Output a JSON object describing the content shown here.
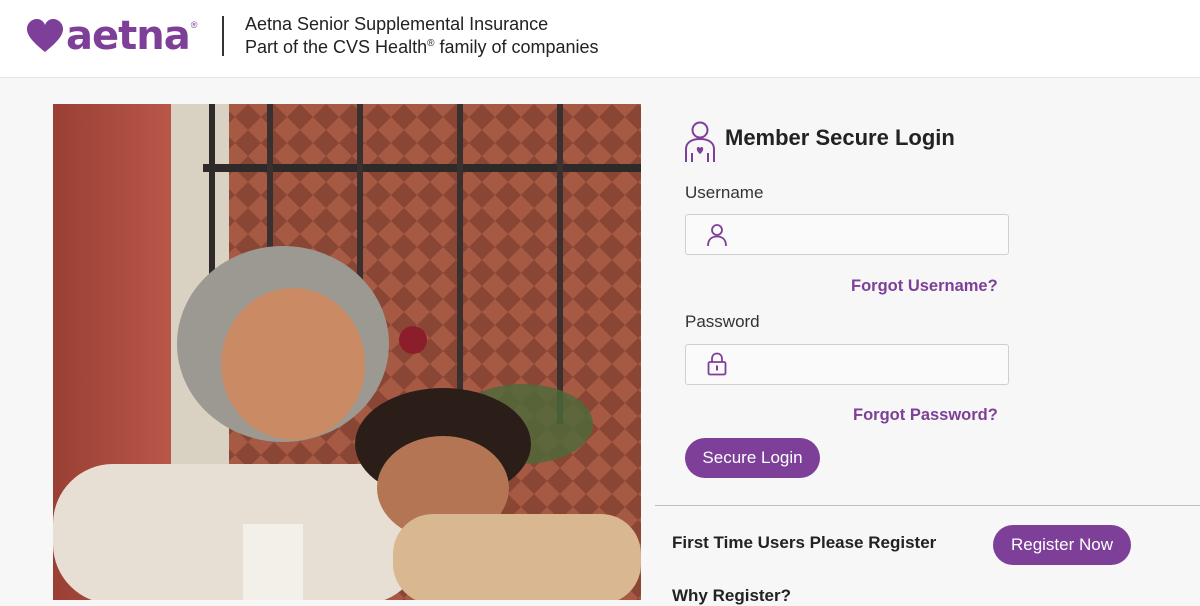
{
  "header": {
    "logo_text": "aetna",
    "logo_reg": "®",
    "line1": "Aetna Senior Supplemental Insurance",
    "line2_prefix": "Part of the CVS Health",
    "line2_reg": "®",
    "line2_suffix": " family of companies"
  },
  "login": {
    "title": "Member Secure Login",
    "username_label": "Username",
    "password_label": "Password",
    "forgot_username": "Forgot Username?",
    "forgot_password": "Forgot Password?",
    "submit_label": "Secure Login"
  },
  "register": {
    "prompt": "First Time Users Please Register",
    "button_label": "Register Now",
    "why_heading": "Why Register?"
  },
  "icons": {
    "logo": "heart-icon",
    "login": "member-person-icon",
    "username": "user-icon",
    "password": "lock-icon"
  },
  "colors": {
    "brand_purple": "#7d3f98",
    "background": "#f7f7f7"
  }
}
